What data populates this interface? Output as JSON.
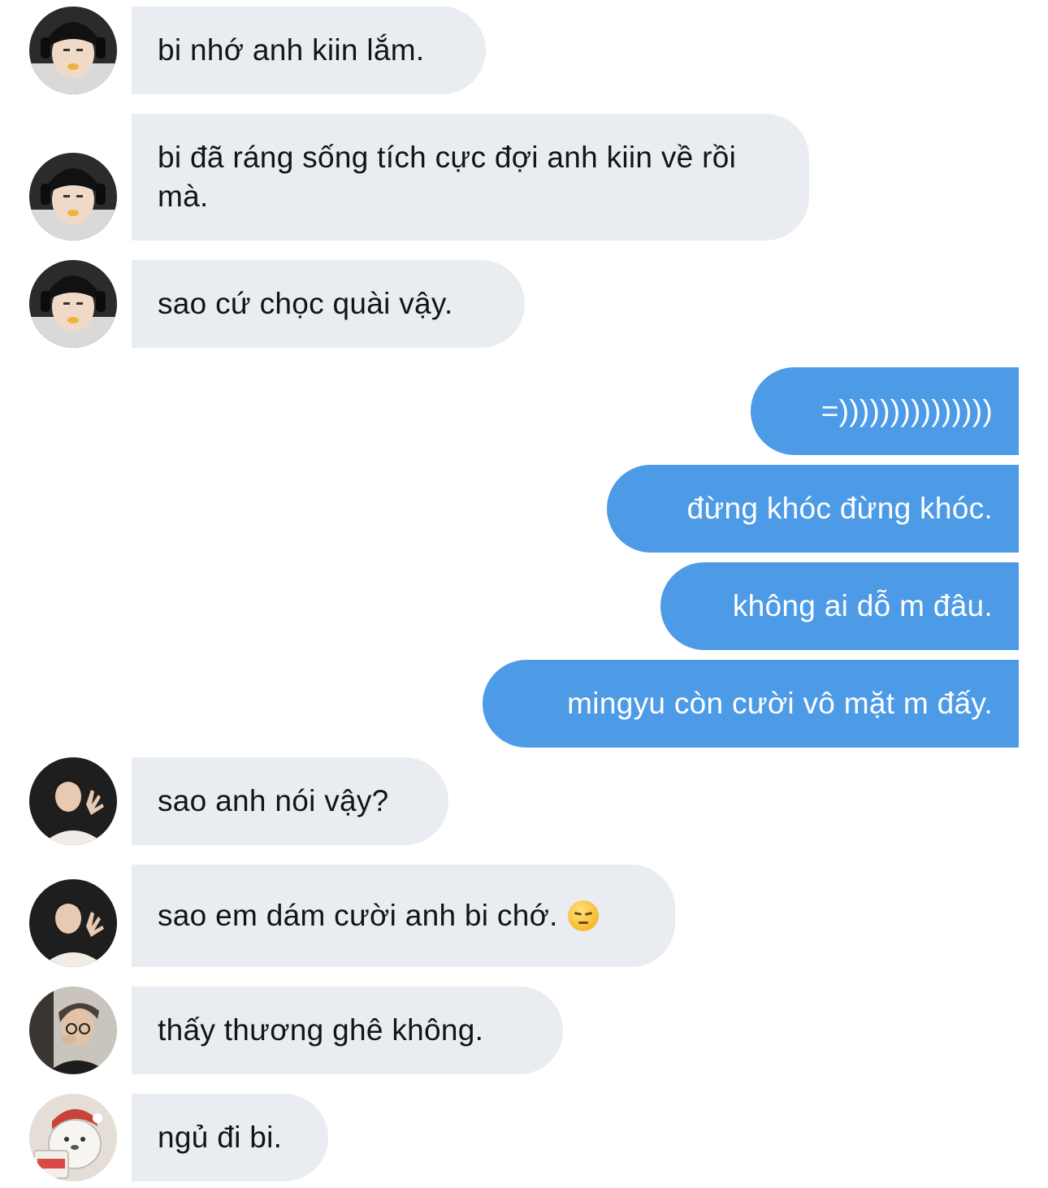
{
  "messages": [
    {
      "sender": "other",
      "avatar": "gamer-headset",
      "text": "bi nhớ anh kiin lắm."
    },
    {
      "sender": "other",
      "avatar": "gamer-headset",
      "text": "bi đã ráng sống tích cực đợi anh kiin về rồi mà."
    },
    {
      "sender": "other",
      "avatar": "gamer-headset",
      "text": "sao cứ chọc quài vậy."
    },
    {
      "sender": "me",
      "text": "=)))))))))))))))"
    },
    {
      "sender": "me",
      "text": "đừng khóc đừng khóc."
    },
    {
      "sender": "me",
      "text": "không ai dỗ m đâu."
    },
    {
      "sender": "me",
      "text": "mingyu còn cười vô mặt m đấy."
    },
    {
      "sender": "other",
      "avatar": "guy-claw-pose",
      "text": "sao anh nói vậy?"
    },
    {
      "sender": "other",
      "avatar": "guy-claw-pose",
      "text": "sao em dám cười anh bi chớ.",
      "emoji": "pensive-face"
    },
    {
      "sender": "other",
      "avatar": "guy-glasses",
      "text": "thấy thương ghê không."
    },
    {
      "sender": "other",
      "avatar": "cartoon-bear",
      "text": "ngủ đi bi."
    }
  ],
  "colors": {
    "incoming_bubble": "#e9ecf1",
    "outgoing_bubble": "#4d9be6",
    "incoming_text": "#141414",
    "outgoing_text": "#ffffff"
  }
}
